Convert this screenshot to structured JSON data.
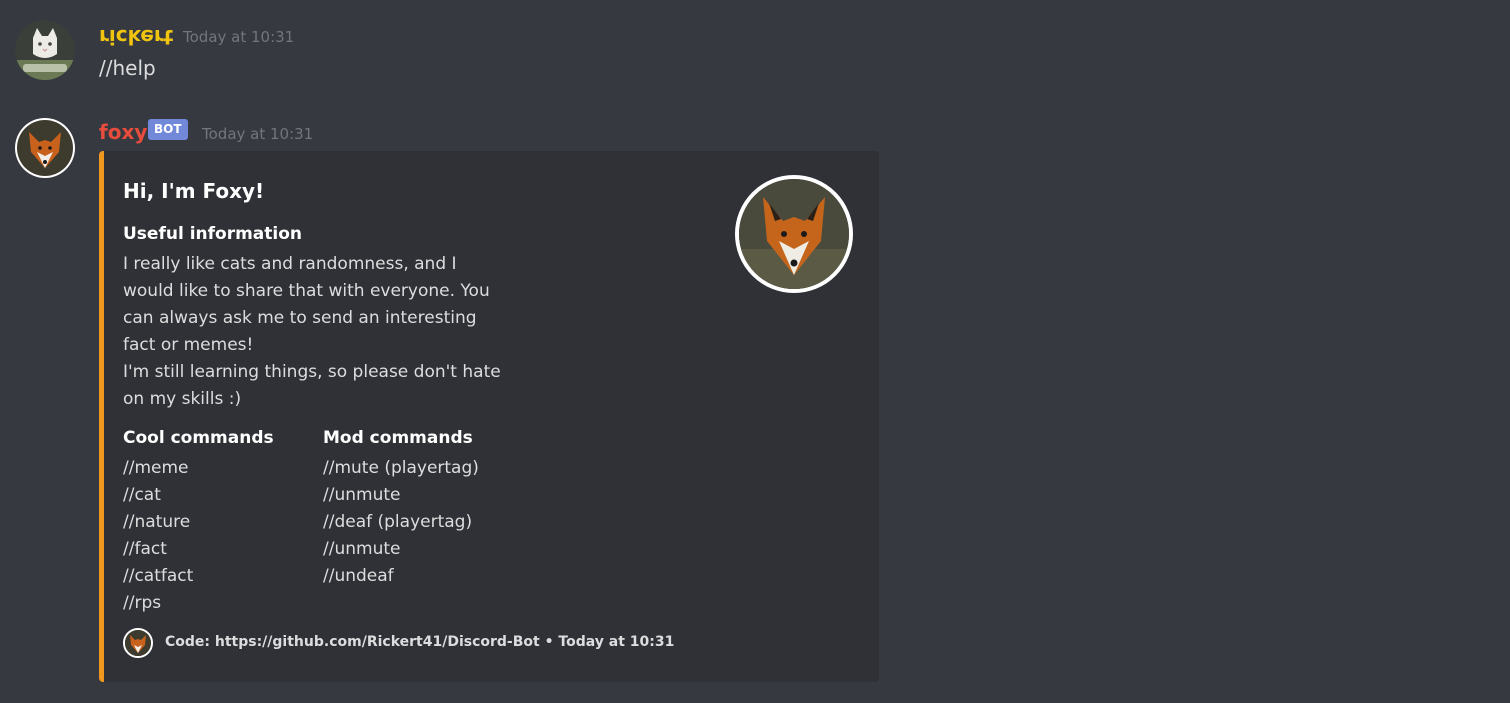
{
  "messages": [
    {
      "username": "rickert",
      "username_color": "#f1c40f",
      "avatar": "cat-avatar",
      "timestamp": "Today at 10:31",
      "text": "//help"
    },
    {
      "username": "foxy",
      "username_color": "#e74c3c",
      "avatar": "fox-avatar",
      "bot_tag": "BOT",
      "bot_tag_color": "#7289da",
      "timestamp": "Today at 10:31"
    }
  ],
  "embed": {
    "accent_color": "#f0981e",
    "title": "Hi, I'm Foxy!",
    "thumbnail": "fox-thumbnail",
    "fields": {
      "useful": {
        "name": "Useful information",
        "lines": [
          "I really like cats and randomness, and I",
          "would like to share that with everyone. You",
          "can always ask me to send an interesting",
          "fact or memes!",
          "I'm still learning things, so please don't hate",
          "on my skills :)"
        ]
      },
      "cool": {
        "name": "Cool commands",
        "lines": [
          "//meme",
          "//cat",
          "//nature",
          "//fact",
          "//catfact",
          "//rps"
        ]
      },
      "mod": {
        "name": "Mod commands",
        "lines": [
          "//mute (playertag)",
          "//unmute",
          "//deaf (playertag)",
          "//unmute",
          "//undeaf"
        ]
      }
    },
    "footer": {
      "icon": "fox-footer-icon",
      "text": "Code: https://github.com/Rickert41/Discord-Bot • Today at 10:31"
    }
  }
}
